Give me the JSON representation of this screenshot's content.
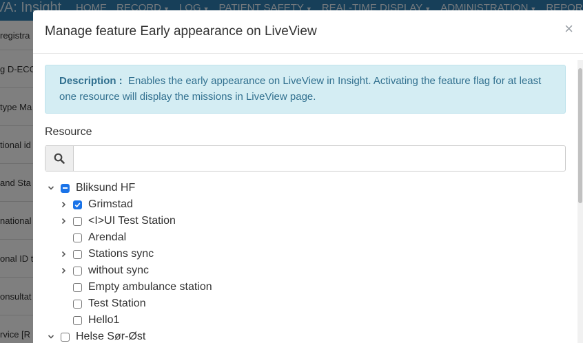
{
  "background": {
    "brand": "VA: Insight",
    "menu": [
      "HOME",
      "RECORD",
      "LOG",
      "PATIENT SAFETY",
      "REAL-TIME DISPLAY",
      "ADMINISTRATION",
      "REPOR"
    ],
    "side_rows": [
      "registra",
      "g D-ECG",
      "type Ma",
      "tional id",
      " and Sta",
      "national",
      "onal ID ty",
      "onsultat",
      "rvice [R"
    ]
  },
  "modal": {
    "title": "Manage feature Early appearance on LiveView",
    "close_label": "×",
    "description_label": "Description :",
    "description_text": "Enables the early appearance on LiveView in Insight. Activating the feature flag for at least one resource will display the missions in LiveView page.",
    "resource_label": "Resource",
    "search_value": "",
    "search_placeholder": ""
  },
  "tree": {
    "root1": {
      "label": "Bliksund HF",
      "state": "partial",
      "expanded": true
    },
    "children": [
      {
        "label": "Grimstad",
        "state": "checked",
        "has_children": true
      },
      {
        "label": "<I>UI Test Station",
        "state": "unchecked",
        "has_children": true
      },
      {
        "label": "Arendal",
        "state": "unchecked",
        "has_children": false
      },
      {
        "label": "Stations sync",
        "state": "unchecked",
        "has_children": true
      },
      {
        "label": "without sync",
        "state": "unchecked",
        "has_children": true
      },
      {
        "label": "Empty ambulance station",
        "state": "unchecked",
        "has_children": false
      },
      {
        "label": "Test Station",
        "state": "unchecked",
        "has_children": false
      },
      {
        "label": "Hello1",
        "state": "unchecked",
        "has_children": false
      }
    ],
    "root2": {
      "label": "Helse Sør-Øst",
      "state": "unchecked",
      "expanded": true
    }
  },
  "colors": {
    "accent": "#1a73e8",
    "info_bg": "#d4edf3",
    "info_text": "#31708f",
    "nav": "#2f7fb3"
  }
}
